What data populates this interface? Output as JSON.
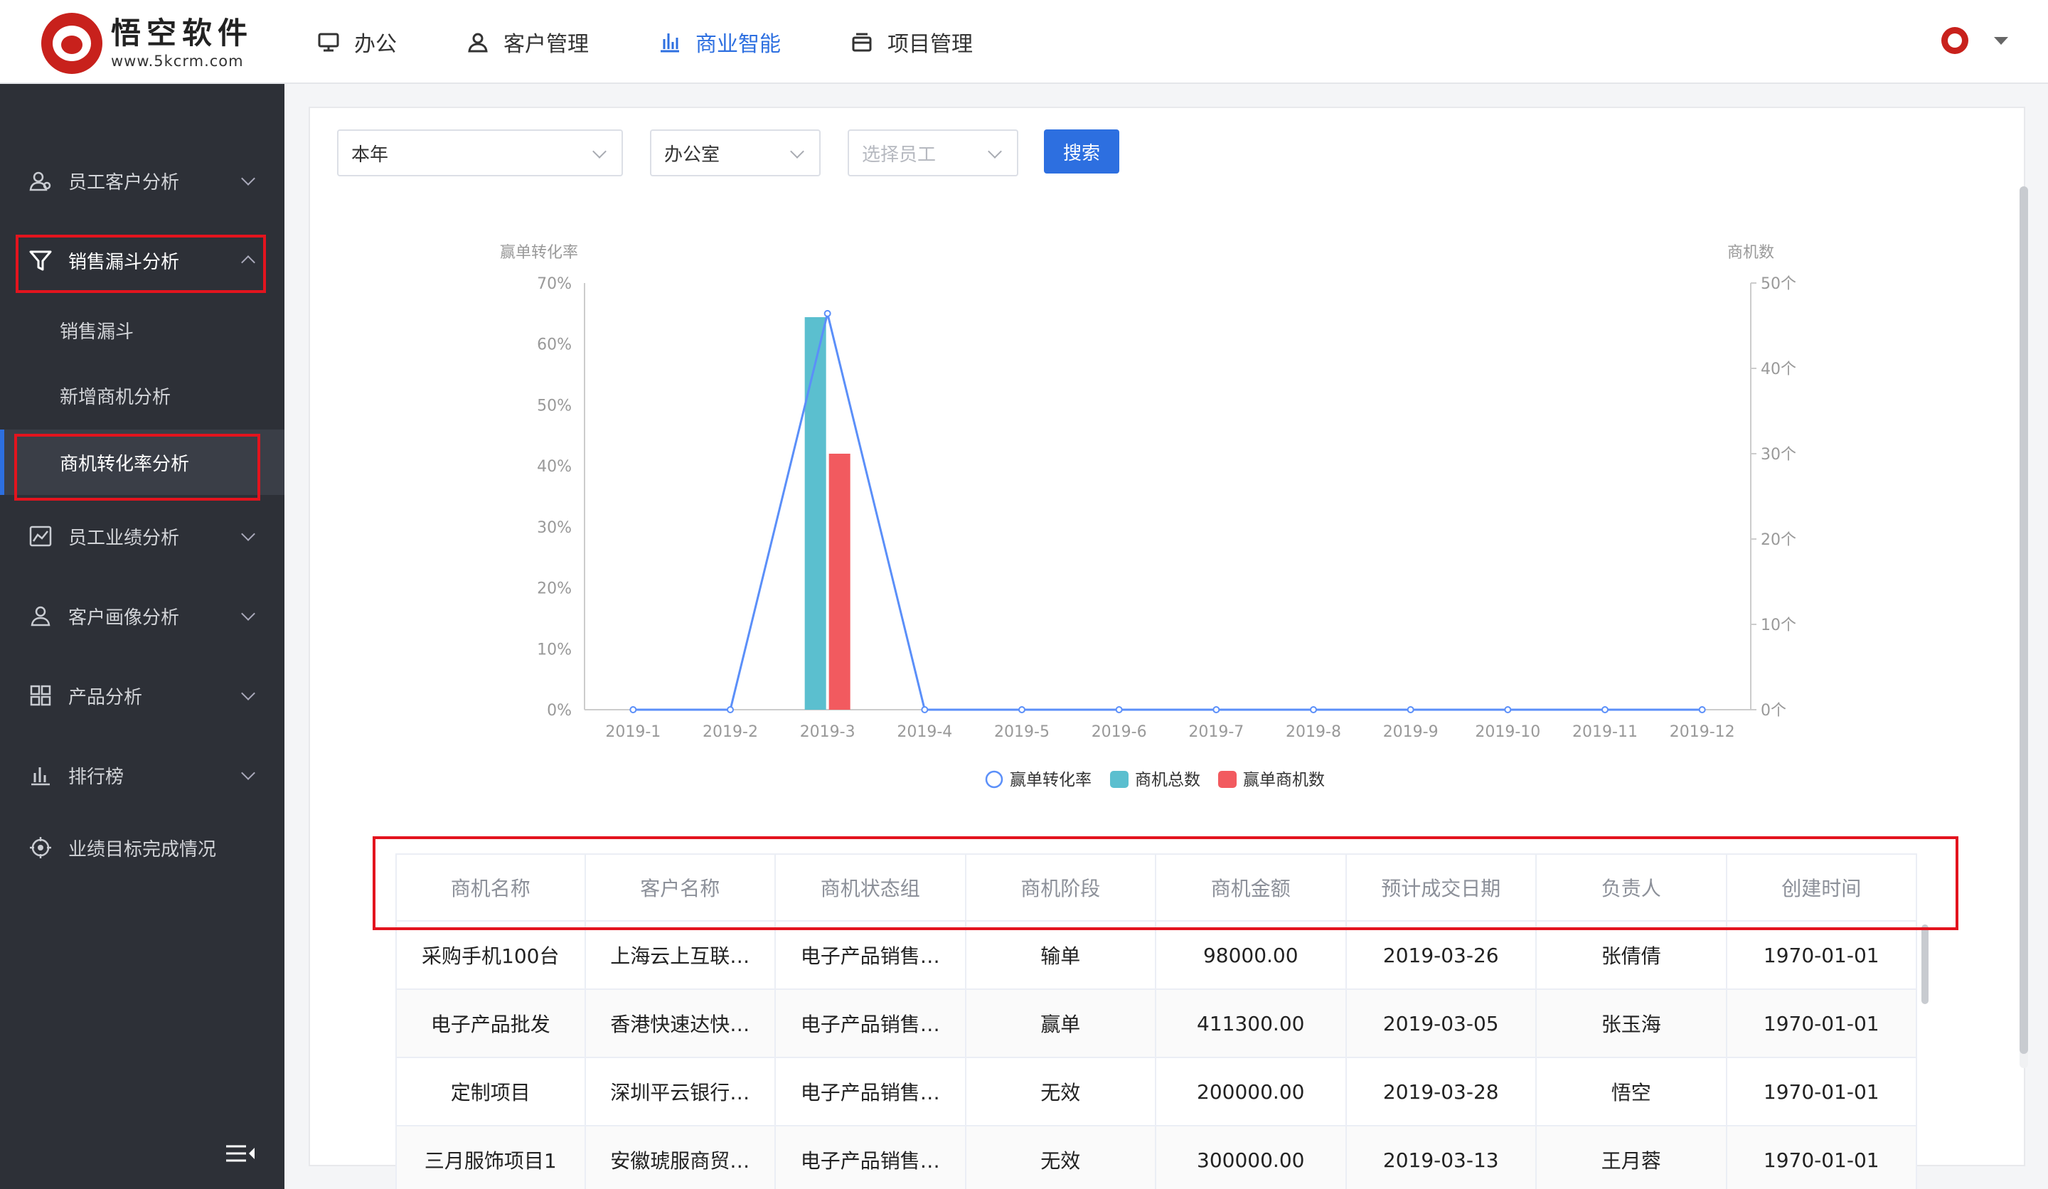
{
  "logo": {
    "name": "悟空软件",
    "url": "www.5kcrm.com"
  },
  "nav": [
    {
      "label": "办公",
      "icon": "monitor-icon"
    },
    {
      "label": "客户管理",
      "icon": "user-icon"
    },
    {
      "label": "商业智能",
      "icon": "bar-chart-icon",
      "active": true
    },
    {
      "label": "项目管理",
      "icon": "folder-icon"
    }
  ],
  "sidebar": {
    "items": [
      {
        "label": "员工客户分析",
        "icon": "user-analysis-icon"
      },
      {
        "label": "销售漏斗分析",
        "icon": "funnel-icon",
        "expanded": true
      },
      {
        "label": "员工业绩分析",
        "icon": "line-chart-icon"
      },
      {
        "label": "客户画像分析",
        "icon": "user-icon"
      },
      {
        "label": "产品分析",
        "icon": "grid-icon"
      },
      {
        "label": "排行榜",
        "icon": "bar-chart-icon"
      },
      {
        "label": "业绩目标完成情况",
        "icon": "target-icon"
      }
    ],
    "subitems": [
      {
        "label": "销售漏斗"
      },
      {
        "label": "新增商机分析"
      },
      {
        "label": "商机转化率分析",
        "active": true
      }
    ]
  },
  "filters": {
    "period": "本年",
    "department": "办公室",
    "employee_placeholder": "选择员工",
    "search_label": "搜索"
  },
  "chart_data": {
    "type": "bar",
    "categories": [
      "2019-1",
      "2019-2",
      "2019-3",
      "2019-4",
      "2019-5",
      "2019-6",
      "2019-7",
      "2019-8",
      "2019-9",
      "2019-10",
      "2019-11",
      "2019-12"
    ],
    "left_axis": {
      "label": "赢单转化率",
      "ticks": [
        "0%",
        "10%",
        "20%",
        "30%",
        "40%",
        "50%",
        "60%",
        "70%"
      ],
      "ylim": [
        0,
        70
      ]
    },
    "right_axis": {
      "label": "商机数",
      "ticks": [
        "0个",
        "10个",
        "20个",
        "30个",
        "40个",
        "50个"
      ],
      "ylim": [
        0,
        50
      ]
    },
    "series": [
      {
        "name": "赢单转化率",
        "type": "line",
        "axis": "left",
        "color": "#5b8ff9",
        "values": [
          0,
          0,
          65,
          0,
          0,
          0,
          0,
          0,
          0,
          0,
          0,
          0
        ]
      },
      {
        "name": "商机总数",
        "type": "bar",
        "axis": "right",
        "color": "#5bbfcf",
        "values": [
          0,
          0,
          46,
          0,
          0,
          0,
          0,
          0,
          0,
          0,
          0,
          0
        ]
      },
      {
        "name": "赢单商机数",
        "type": "bar",
        "axis": "right",
        "color": "#f25a5f",
        "values": [
          0,
          0,
          30,
          0,
          0,
          0,
          0,
          0,
          0,
          0,
          0,
          0
        ]
      }
    ],
    "legend_position": "bottom"
  },
  "table": {
    "columns": [
      "商机名称",
      "客户名称",
      "商机状态组",
      "商机阶段",
      "商机金额",
      "预计成交日期",
      "负责人",
      "创建时间"
    ],
    "rows": [
      [
        "采购手机100台",
        "上海云上互联…",
        "电子产品销售…",
        "输单",
        "98000.00",
        "2019-03-26",
        "张倩倩",
        "1970-01-01"
      ],
      [
        "电子产品批发",
        "香港快速达快…",
        "电子产品销售…",
        "赢单",
        "411300.00",
        "2019-03-05",
        "张玉海",
        "1970-01-01"
      ],
      [
        "定制项目",
        "深圳平云银行…",
        "电子产品销售…",
        "无效",
        "200000.00",
        "2019-03-28",
        "悟空",
        "1970-01-01"
      ],
      [
        "三月服饰项目1",
        "安徽琥服商贸…",
        "电子产品销售…",
        "无效",
        "300000.00",
        "2019-03-13",
        "王月蓉",
        "1970-01-01"
      ]
    ]
  }
}
